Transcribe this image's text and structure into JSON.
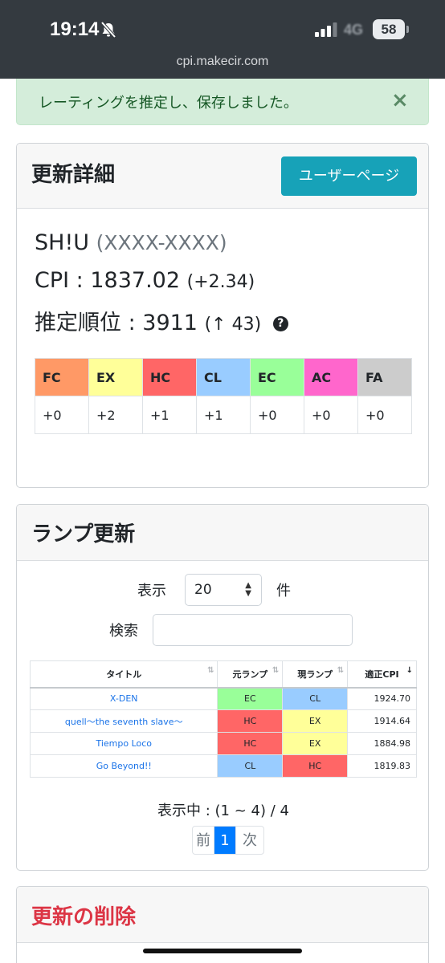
{
  "status_bar": {
    "time": "19:14",
    "network": "4G",
    "battery": "58",
    "url": "cpi.makecir.com"
  },
  "alert": {
    "message": "レーティングを推定し、保存しました。",
    "close": "×"
  },
  "update_detail": {
    "title": "更新詳細",
    "user_page_button": "ユーザーページ",
    "player_name": "SH!U",
    "player_id": "(XXXX-XXXX)",
    "cpi_label": "CPI : 1837.02",
    "cpi_delta": "(+2.34)",
    "rank_label": "推定順位 : 3911",
    "rank_delta": "(↑ 43)",
    "help_icon": "?",
    "lamp_summary": {
      "headers": [
        "FC",
        "EX",
        "HC",
        "CL",
        "EC",
        "AC",
        "FA"
      ],
      "colors": [
        "#ff9966",
        "#ffff99",
        "#ff6666",
        "#99ccff",
        "#99ff99",
        "#ff66cc",
        "#cccccc"
      ],
      "values": [
        "+0",
        "+2",
        "+1",
        "+1",
        "+0",
        "+0",
        "+0"
      ]
    }
  },
  "lamp_update": {
    "title": "ランプ更新",
    "show_label": "表示",
    "page_size": "20",
    "count_suffix": "件",
    "search_label": "検索",
    "columns": [
      "タイトル",
      "元ランプ",
      "現ランプ",
      "適正CPI"
    ],
    "rows": [
      {
        "title": "X-DEN",
        "old": "EC",
        "new": "CL",
        "cpi": "1924.70"
      },
      {
        "title": "quell～the seventh slave～",
        "old": "HC",
        "new": "EX",
        "cpi": "1914.64"
      },
      {
        "title": "Tiempo Loco",
        "old": "HC",
        "new": "EX",
        "cpi": "1884.98"
      },
      {
        "title": "Go Beyond!!",
        "old": "CL",
        "new": "HC",
        "cpi": "1819.83"
      }
    ],
    "lamp_colors": {
      "EC": "#99ff99",
      "CL": "#99ccff",
      "HC": "#ff6666",
      "EX": "#ffff99"
    },
    "paging_info": "表示中 : (1 ~ 4) / 4",
    "pager": {
      "prev": "前",
      "current": "1",
      "next": "次"
    }
  },
  "delete_section": {
    "title": "更新の削除",
    "title_color": "#dc3545"
  }
}
